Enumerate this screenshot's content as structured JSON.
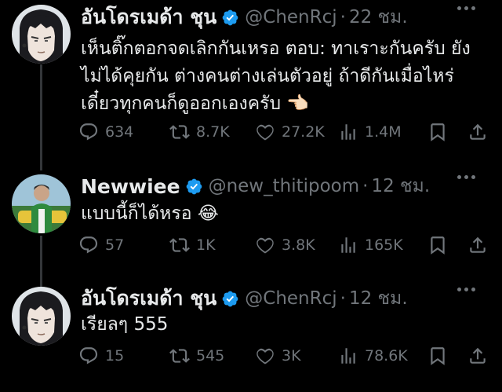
{
  "tweets": [
    {
      "name": "อันโดรเมด้า ชุน",
      "handle": "@ChenRcj",
      "dot": "·",
      "time": "22 ชม.",
      "text_lines": [
        "เห็นติ๊กตอกจดเลิกกันเหรอ  ตอบ: ทาเราะกันครับ ยัง",
        "ไม่ได้คุยกัน ต่างคนต่างเล่นตัวอยู่ ถ้าดีกันเมื่อไหร่",
        "เดี๋ยวทุกคนก็ดูออกเองครับ 👈🏻"
      ],
      "replies": "634",
      "retweets": "8.7K",
      "likes": "27.2K",
      "views": "1.4M"
    },
    {
      "name": "Newwiee",
      "handle": "@new_thitipoom",
      "dot": "·",
      "time": "12 ชม.",
      "text_lines": [
        "แบบนี้ก็ได้หรอ 😂"
      ],
      "replies": "57",
      "retweets": "1K",
      "likes": "3.8K",
      "views": "165K"
    },
    {
      "name": "อันโดรเมด้า ชุน",
      "handle": "@ChenRcj",
      "dot": "·",
      "time": "12 ชม.",
      "text_lines": [
        "เรียลๆ 555"
      ],
      "replies": "15",
      "retweets": "545",
      "likes": "3K",
      "views": "78.6K"
    }
  ],
  "colors": {
    "background": "#000000",
    "text": "#e7e9ea",
    "muted": "#71767b",
    "verified": "#1d9bf0",
    "thread_line": "#333639"
  },
  "icons": [
    "verified-badge-icon",
    "more-icon",
    "reply-icon",
    "retweet-icon",
    "like-icon",
    "views-icon",
    "bookmark-icon",
    "share-icon"
  ]
}
